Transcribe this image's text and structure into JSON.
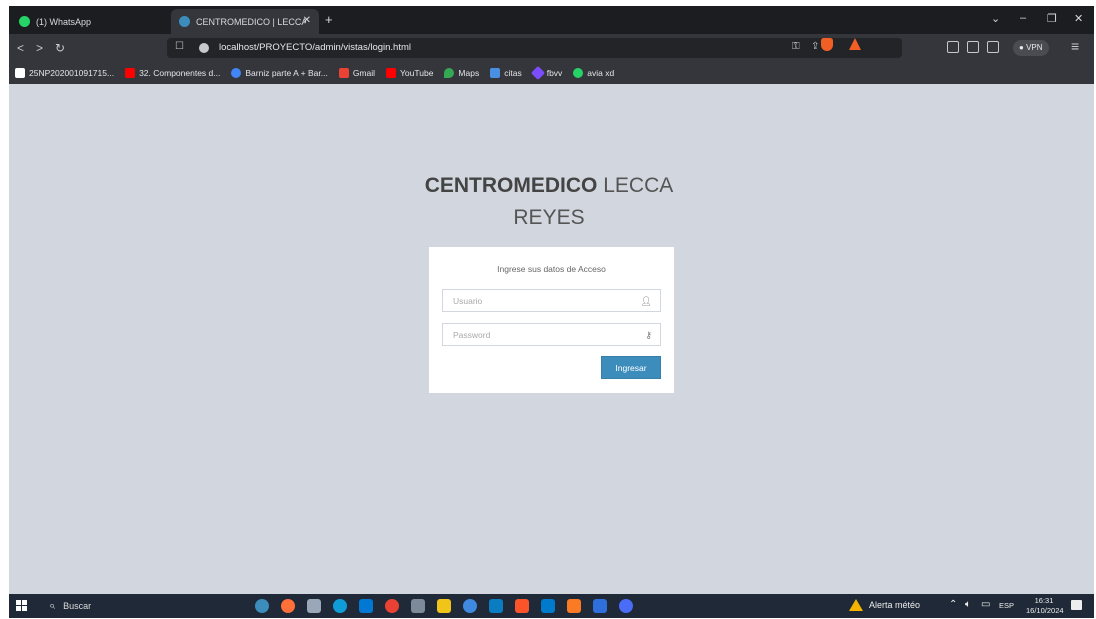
{
  "browser": {
    "tabs": [
      {
        "title": "(1) WhatsApp",
        "icon": "whatsapp-icon",
        "color": "#25d366"
      },
      {
        "title": "CENTROMEDICO | LECCA REYE",
        "icon": "site-favicon",
        "color": "#3c8dbc",
        "active": true
      }
    ],
    "new_tab": "+",
    "window_controls": {
      "menu": "⌄",
      "minimize": "–",
      "restore": "❐",
      "close": "✕"
    },
    "url": "localhost/PROYECTO/admin/vistas/login.html",
    "vpn_label": "VPN",
    "bookmarks": [
      {
        "label": "25NP202001091715...",
        "icon": "m-icon",
        "color": "#ffffff"
      },
      {
        "label": "32. Componentes d...",
        "icon": "youtube-icon",
        "color": "#ff0000"
      },
      {
        "label": "Barniz parte A + Bar...",
        "icon": "google-icon",
        "color": "#4285f4"
      },
      {
        "label": "Gmail",
        "icon": "gmail-icon",
        "color": "#ea4335"
      },
      {
        "label": "YouTube",
        "icon": "youtube-icon",
        "color": "#ff0000"
      },
      {
        "label": "Maps",
        "icon": "maps-icon",
        "color": "#34a853"
      },
      {
        "label": "citas",
        "icon": "citas-icon",
        "color": "#4a90e2"
      },
      {
        "label": "fbvv",
        "icon": "fbvv-icon",
        "color": "#7c4dff"
      },
      {
        "label": "avia xd",
        "icon": "whatsapp-icon",
        "color": "#25d366"
      }
    ]
  },
  "login": {
    "brand_bold": "CENTROMEDICO",
    "brand_light": "LECCA",
    "brand_line2": "REYES",
    "message": "Ingrese sus datos de Acceso",
    "username_placeholder": "Usuario",
    "password_placeholder": "Password",
    "submit_label": "Ingresar",
    "accent_color": "#3c8dbc"
  },
  "taskbar": {
    "search_placeholder": "Buscar",
    "weather": "Alerta météo",
    "language": "ESP",
    "time": "16:31",
    "date": "16/10/2024"
  }
}
